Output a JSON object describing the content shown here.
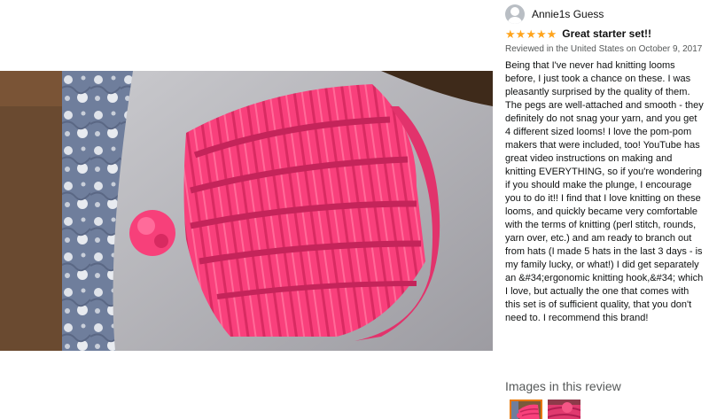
{
  "reviewer": {
    "name": "Annie1s Guess"
  },
  "review": {
    "rating_stars": 5,
    "title": "Great starter set!!",
    "date": "Reviewed in the United States on October 9, 2017",
    "body": "Being that I've never had knitting looms before, I just took a chance on these. I was pleasantly surprised by the quality of them. The pegs are well-attached and smooth - they definitely do not snag your yarn, and you get 4 different sized looms! I love the pom-pom makers that were included, too! YouTube has great video instructions on making and knitting EVERYTHING, so if you're wondering if you should make the plunge, I encourage you to do it!! I find that I love knitting on these looms, and quickly became very comfortable with the terms of knitting (perl stitch, rounds, yarn over, etc.) and am ready to branch out from hats (I made 5 hats in the last 3 days - is my family lucky, or what!) I did get separately an &#34;ergonomic knitting hook,&#34; which I love, but actually the one that comes with this set is of sufficient quality, that you don't need to. I recommend this brand!"
  },
  "images_section": {
    "heading": "Images in this review",
    "thumbnail_count": 2,
    "selected_index": 0
  },
  "colors": {
    "star": "#ffa41c",
    "selected_border": "#e77600",
    "hat_pink": "#f9407c"
  }
}
